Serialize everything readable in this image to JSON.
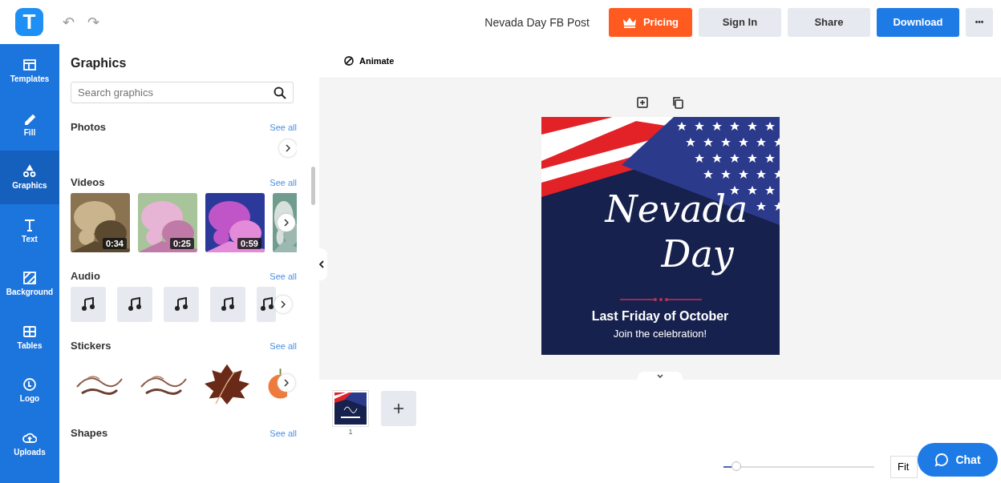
{
  "header": {
    "undo": "↶",
    "redo": "↷",
    "logo": "T",
    "document_title": "Nevada Day FB Post",
    "buttons": [
      {
        "kind": "pricing",
        "label": "Pricing"
      },
      {
        "kind": "plain",
        "label": "Sign In"
      },
      {
        "kind": "plain",
        "label": "Share"
      },
      {
        "kind": "primary",
        "label": "Download"
      },
      {
        "kind": "more",
        "label": "•••"
      }
    ]
  },
  "sidebar": {
    "items": [
      {
        "kind": "templates",
        "label": "Templates",
        "selected": false
      },
      {
        "kind": "fill",
        "label": "Fill",
        "selected": false
      },
      {
        "kind": "graphics",
        "label": "Graphics",
        "selected": true
      },
      {
        "kind": "text",
        "label": "Text",
        "selected": false
      },
      {
        "kind": "background",
        "label": "Background",
        "selected": false
      },
      {
        "kind": "tables",
        "label": "Tables",
        "selected": false
      },
      {
        "kind": "logo",
        "label": "Logo",
        "selected": false
      },
      {
        "kind": "uploads",
        "label": "Uploads",
        "selected": false
      }
    ]
  },
  "panel": {
    "title": "Graphics",
    "search": {
      "placeholder": "Search graphics"
    },
    "sections": [
      {
        "kind": "photos",
        "title": "Photos",
        "link": "See all"
      },
      {
        "kind": "videos",
        "title": "Videos",
        "link": "See all",
        "items": [
          {
            "kind": "clip",
            "duration": "0:34"
          },
          {
            "kind": "clip",
            "duration": "0:25"
          },
          {
            "kind": "clip",
            "duration": "0:59"
          },
          {
            "kind": "partial"
          }
        ]
      },
      {
        "kind": "audio",
        "title": "Audio",
        "link": "See all",
        "items": [
          {
            "kind": "track"
          },
          {
            "kind": "track"
          },
          {
            "kind": "track"
          },
          {
            "kind": "track"
          },
          {
            "kind": "partial"
          }
        ]
      },
      {
        "kind": "stickers",
        "title": "Stickers",
        "link": "See all"
      },
      {
        "kind": "shapes",
        "title": "Shapes",
        "link": "See all"
      }
    ]
  },
  "toolbar": {
    "animate": "Animate"
  },
  "design": {
    "script_title": "Nevada",
    "script_title_2": "Day",
    "headline": "Last Friday of October",
    "subline": "Join the celebration!"
  },
  "pages": [
    {
      "number": "1",
      "selected": true
    }
  ],
  "zoom": {
    "level": 0.05,
    "fit": "Fit"
  },
  "chat": {
    "label": "Chat"
  }
}
